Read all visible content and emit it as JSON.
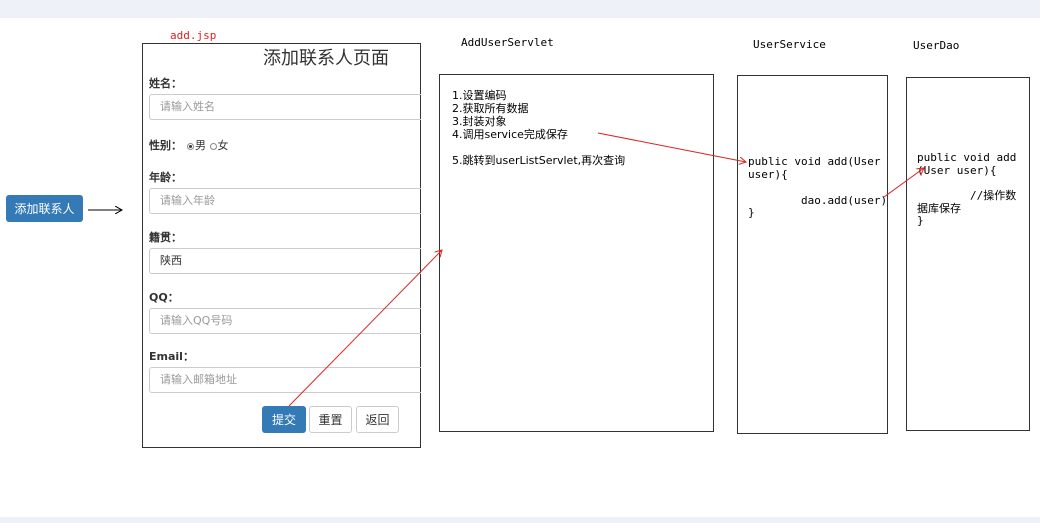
{
  "add_button_label": "添加联系人",
  "form": {
    "file": "add.jsp",
    "title": "添加联系人页面",
    "name_label": "姓名：",
    "name_placeholder": "请输入姓名",
    "gender_label": "性别：",
    "gender_male": "男",
    "gender_female": "女",
    "age_label": "年龄：",
    "age_placeholder": "请输入年龄",
    "origin_label": "籍贯：",
    "origin_value": "陕西",
    "qq_label": "QQ：",
    "qq_placeholder": "请输入QQ号码",
    "email_label": "Email：",
    "email_placeholder": "请输入邮箱地址",
    "submit_label": "提交",
    "reset_label": "重置",
    "back_label": "返回"
  },
  "servlet": {
    "title": "AddUserServlet",
    "step1": "1.设置编码",
    "step2": "2.获取所有数据",
    "step3": "3.封装对象",
    "step4": "4.调用service完成保存",
    "step5": "5.跳转到userListServlet,再次查询"
  },
  "service": {
    "title": "UserService",
    "line1": "public void add(User",
    "line2": "user){",
    "line3": "dao.add(user)",
    "line4": "}"
  },
  "dao": {
    "title": "UserDao",
    "line1": "public void add",
    "line2": "(User user){",
    "line3": "//操作数",
    "line4": "据库保存",
    "line5": "}"
  },
  "colors": {
    "primary": "#337ab7",
    "arrow_red": "#e02020",
    "jsp_label": "#e02020",
    "band": "#eef2f8"
  }
}
